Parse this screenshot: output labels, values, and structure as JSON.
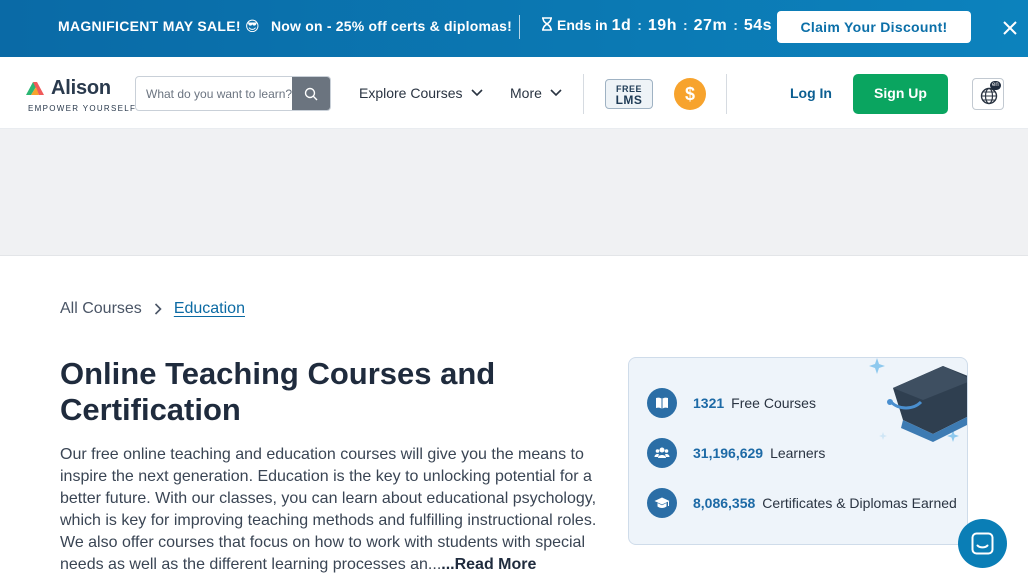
{
  "promo": {
    "sale_label": "MAGNIFICENT MAY SALE! 😎",
    "offer_text": "Now on - 25% off certs & diplomas!",
    "ends_label": "Ends in",
    "days": "1d",
    "hours": "19h",
    "minutes": "27m",
    "seconds": "54s",
    "claim_label": "Claim Your Discount!"
  },
  "header": {
    "logo_name": "Alison",
    "logo_tagline": "EMPOWER YOURSELF",
    "search_placeholder": "What do you want to learn?",
    "explore_label": "Explore Courses",
    "more_label": "More",
    "free_lms_line1": "FREE",
    "free_lms_line2": "LMS",
    "coin_symbol": "$",
    "login_label": "Log In",
    "signup_label": "Sign Up",
    "lang_badge": "en"
  },
  "breadcrumb": {
    "all": "All Courses",
    "current": "Education"
  },
  "main": {
    "title": "Online Teaching Courses and Certification",
    "description": "Our free online teaching and education courses will give you the means to inspire the next generation. Education is the key to unlocking potential for a better future. With our classes, you can learn about educational psychology, which is key for improving teaching methods and fulfilling instructional roles. We also offer courses that focus on how to work with students with special needs as well as the different learning processes an...",
    "read_more": "...Read More"
  },
  "stats": [
    {
      "number": "1321",
      "label": "Free Courses",
      "icon": "book-icon"
    },
    {
      "number": "31,196,629",
      "label": "Learners",
      "icon": "users-icon"
    },
    {
      "number": "8,086,358",
      "label": "Certificates & Diplomas Earned",
      "icon": "graduation-cap-icon"
    }
  ],
  "colors": {
    "brand_blue": "#0b6fa8",
    "signup_green": "#0aa560",
    "coin_orange": "#f7a32d",
    "stat_blue": "#1d6aa6"
  }
}
